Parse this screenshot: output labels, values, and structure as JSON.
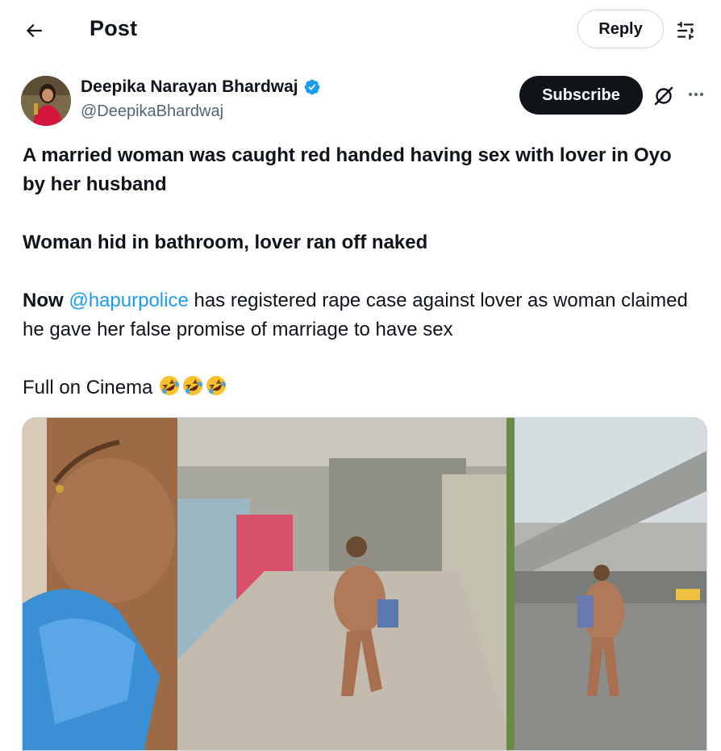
{
  "header": {
    "title": "Post",
    "reply_label": "Reply",
    "back_icon": "arrow-left-icon",
    "filter_icon": "sliders-icon"
  },
  "author": {
    "name": "Deepika Narayan Bhardwaj",
    "handle": "@DeepikaBhardwaj",
    "verified": true,
    "verified_color": "#1d9bf0"
  },
  "actions": {
    "subscribe_label": "Subscribe",
    "grok_icon": "grok-icon",
    "more_icon": "more-icon"
  },
  "post": {
    "line1": "A married woman was caught red handed having sex with lover in Oyo by her husband",
    "line2": "Woman hid in bathroom, lover ran off naked",
    "line3_lead": "Now",
    "mention": "@hapurpolice",
    "line3_rest": "has registered rape case against lover as woman claimed he gave her false promise of marriage to have sex",
    "line4": "Full on Cinema",
    "emojis": [
      "rolling-on-floor-laughing-emoji",
      "rolling-on-floor-laughing-emoji",
      "rolling-on-floor-laughing-emoji"
    ]
  },
  "colors": {
    "text": "#0f1419",
    "secondary": "#536471",
    "link": "#1d9bf0",
    "button_dark": "#0f1419"
  }
}
